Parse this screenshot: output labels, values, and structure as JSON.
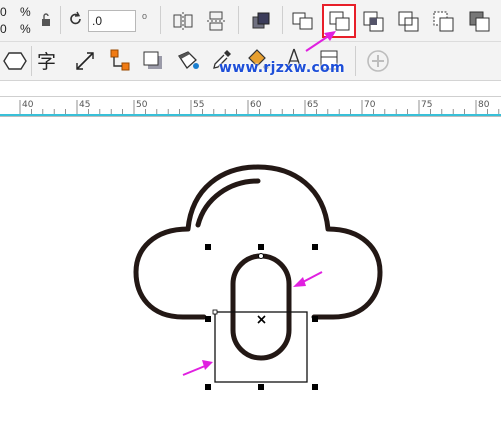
{
  "toolbar": {
    "size_top": "0",
    "size_bottom": "0",
    "percent_top": "%",
    "percent_bottom": "%",
    "rotation_value": ".0"
  },
  "ruler": {
    "ticks": [
      "40",
      "45",
      "50",
      "55",
      "60",
      "65",
      "70",
      "75",
      "80"
    ]
  },
  "watermark": "www.rjzxw.com",
  "toolbar2": {
    "text_tool_glyph": "字"
  },
  "colors": {
    "accent_highlight": "#e8202a",
    "arrow_pink": "#e020e0",
    "ruler_line": "#39c0d8",
    "shape_stroke": "#231815"
  }
}
